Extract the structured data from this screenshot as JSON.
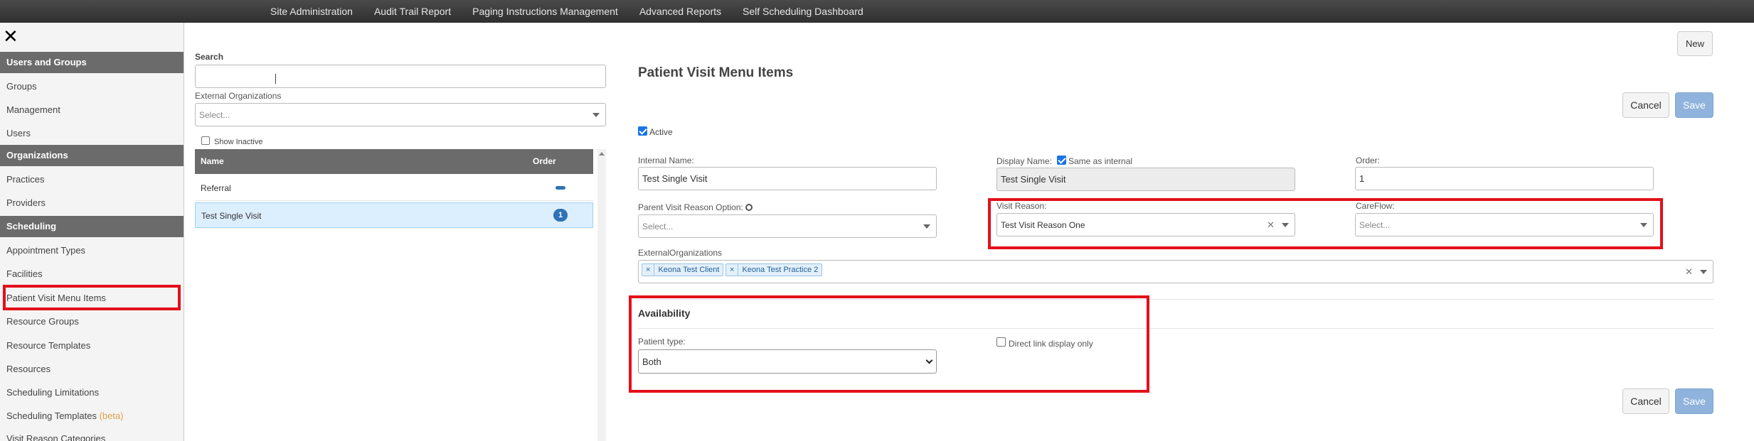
{
  "topnav": {
    "items": [
      "Site Administration",
      "Audit Trail Report",
      "Paging Instructions Management",
      "Advanced Reports",
      "Self Scheduling Dashboard"
    ]
  },
  "sidebar": {
    "close_glyph": "✕",
    "sections": {
      "users_groups": "Users and Groups",
      "organizations": "Organizations",
      "scheduling": "Scheduling"
    },
    "items": {
      "groups": "Groups",
      "management": "Management",
      "users": "Users",
      "practices": "Practices",
      "providers": "Providers",
      "appointment_types": "Appointment Types",
      "facilities": "Facilities",
      "patient_visit_menu_items": "Patient Visit Menu Items",
      "resource_groups": "Resource Groups",
      "resource_templates": "Resource Templates",
      "resources": "Resources",
      "scheduling_limitations": "Scheduling Limitations",
      "scheduling_templates": "Scheduling Templates",
      "beta": "(beta)",
      "visit_reason_categories": "Visit Reason Categories"
    }
  },
  "list_panel": {
    "search_label": "Search",
    "search_value": "",
    "ext_org_label": "External Organizations",
    "ext_org_placeholder": "Select...",
    "show_inactive_label": "Show Inactive",
    "table_headers": {
      "name": "Name",
      "order": "Order"
    },
    "rows": [
      {
        "name": "Referral",
        "order": ""
      },
      {
        "name": "Test Single Visit",
        "order": "1"
      }
    ]
  },
  "form": {
    "new_button": "New",
    "title": "Patient Visit Menu Items",
    "cancel_label": "Cancel",
    "save_label": "Save",
    "active_label": "Active",
    "internal_name_label": "Internal Name:",
    "internal_name_value": "Test Single Visit",
    "display_name_label": "Display Name:",
    "same_as_internal_label": "Same as internal",
    "display_name_value": "Test Single Visit",
    "order_label": "Order:",
    "order_value": "1",
    "parent_visit_label": "Parent Visit Reason Option:",
    "parent_visit_placeholder": "Select...",
    "visit_reason_label": "Visit Reason:",
    "visit_reason_value": "Test Visit Reason One",
    "careflow_label": "CareFlow:",
    "careflow_placeholder": "Select...",
    "external_orgs_label": "ExternalOrganizations",
    "external_orgs_tags": [
      "Keona Test Client",
      "Keona Test Practice 2"
    ],
    "availability_heading": "Availability",
    "patient_type_label": "Patient type:",
    "patient_type_value": "Both",
    "direct_link_label": "Direct link display only"
  },
  "colors": {
    "topbar": "#3a3a3a",
    "section_header": "#6b6b6b",
    "highlight_red": "#e3101a",
    "selected_row": "#dcefff",
    "primary_button": "#8fb3dc",
    "badge_blue": "#2f72b5"
  }
}
